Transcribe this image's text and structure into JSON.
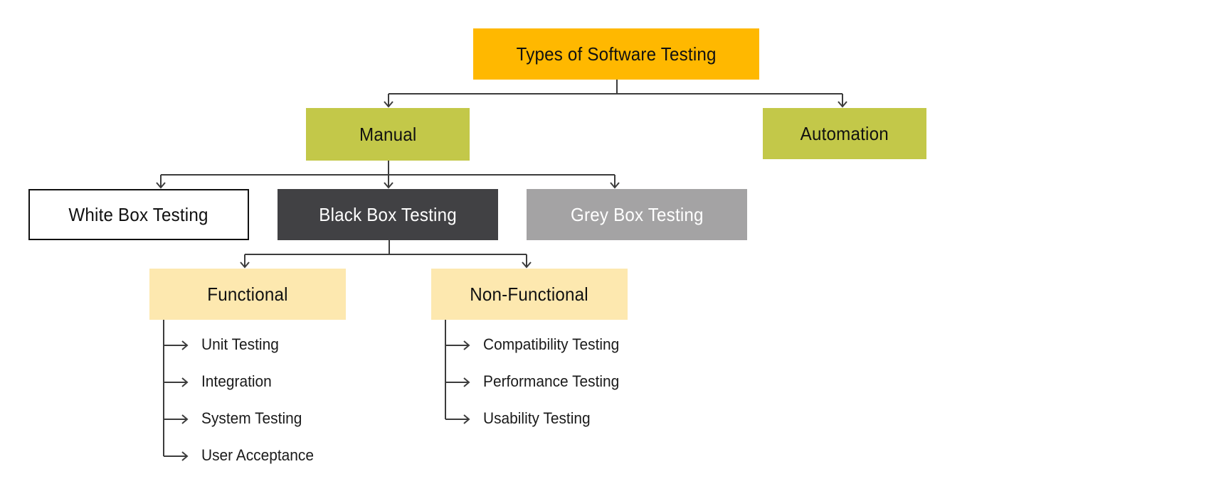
{
  "diagram": {
    "title": "Types of Software Testing",
    "colors": {
      "root": "#FFB800",
      "level1": "#C3C849",
      "white_box_fill": "#FFFFFF",
      "white_box_border": "#111111",
      "black_box": "#414144",
      "grey_box": "#A4A3A4",
      "category": "#FDE8AF",
      "connector": "#3C3C3C",
      "dark_text": "#111111",
      "light_text": "#FFFFFF"
    },
    "root": {
      "label": "Types of Software Testing"
    },
    "level1": [
      {
        "id": "manual",
        "label": "Manual"
      },
      {
        "id": "automation",
        "label": "Automation"
      }
    ],
    "manual_children": [
      {
        "id": "white",
        "label": "White Box Testing"
      },
      {
        "id": "black",
        "label": "Black Box Testing"
      },
      {
        "id": "grey",
        "label": "Grey Box Testing"
      }
    ],
    "black_box_children": [
      {
        "id": "functional",
        "label": "Functional",
        "items": [
          "Unit Testing",
          "Integration",
          "System Testing",
          "User Acceptance"
        ]
      },
      {
        "id": "non_functional",
        "label": "Non-Functional",
        "items": [
          "Compatibility Testing",
          "Performance Testing",
          "Usability Testing"
        ]
      }
    ]
  }
}
